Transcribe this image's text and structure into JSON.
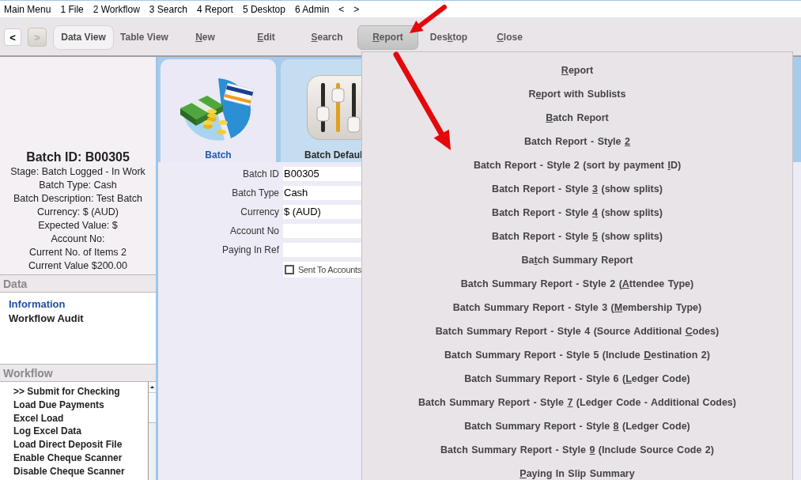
{
  "menu_bar": {
    "items": [
      "Main Menu",
      "1 File",
      "2 Workflow",
      "3 Search",
      "4 Report",
      "5 Desktop",
      "6 Admin",
      "<",
      ">"
    ]
  },
  "toolbar": {
    "nav": [
      {
        "label": "<",
        "disabled": false
      },
      {
        "label": ">",
        "disabled": true
      }
    ],
    "buttons": [
      {
        "label": "Data View",
        "selected": true,
        "expanded": false
      },
      {
        "label": "Table View",
        "selected": false,
        "expanded": false
      },
      {
        "access_key": "N",
        "text_after": "ew",
        "selected": false,
        "expanded": false
      },
      {
        "access_key": "E",
        "text_after": "dit",
        "selected": false,
        "expanded": false
      },
      {
        "access_key": "S",
        "text_after": "earch",
        "selected": false,
        "expanded": false
      },
      {
        "access_key": "R",
        "text_after": "eport",
        "selected": false,
        "expanded": true
      },
      {
        "text_before": "Des",
        "access_key": "k",
        "text_after": "top",
        "selected": false,
        "expanded": false
      },
      {
        "access_key": "C",
        "text_after": "lose",
        "selected": false,
        "expanded": false
      }
    ]
  },
  "summary": {
    "title": "Batch ID: B00305",
    "lines": [
      "Stage: Batch Logged - In Work",
      "Batch Type: Cash",
      "Batch Description: Test Batch",
      "Currency: $ (AUD)",
      "Expected Value: $",
      "Account No:",
      "Current No. of Items 2",
      "Current Value $200.00"
    ]
  },
  "data_section": {
    "title": "Data",
    "items": [
      {
        "label": "Information",
        "selected": true
      },
      {
        "label": "Workflow Audit",
        "selected": false
      }
    ]
  },
  "workflow_section": {
    "title": "Workflow",
    "items": [
      ">> Submit for Checking",
      "Load Due Payments",
      "Excel Load",
      "Log Excel Data",
      "Load Direct Deposit File",
      "Enable Cheque Scanner",
      "Disable Cheque Scanner"
    ]
  },
  "tabs": [
    {
      "label": "Batch",
      "selected": true
    },
    {
      "label": "Batch Defaul",
      "selected": false
    }
  ],
  "form": {
    "fields": [
      {
        "label": "Batch ID",
        "value": "B00305"
      },
      {
        "label": "Batch Type",
        "value": "Cash"
      },
      {
        "label": "Currency",
        "value": "$ (AUD)"
      },
      {
        "label": "Account No"
      },
      {
        "label": "Paying In Ref"
      }
    ],
    "checkbox": {
      "label": "Sent To Accounts",
      "checked": false
    }
  },
  "report_menu": {
    "items": [
      {
        "access_key": "R",
        "text_after": "eport"
      },
      {
        "text_before": "R",
        "access_key": "e",
        "text_after": "port with Sublists"
      },
      {
        "access_key": "B",
        "text_after": "atch Report"
      },
      {
        "text_before": "Batch Report - Style ",
        "access_key": "2"
      },
      {
        "text_before": "Batch Report - Style 2 (sort by payment ",
        "access_key": "I",
        "text_after": "D)"
      },
      {
        "text_before": "Batch Report - Style ",
        "access_key": "3",
        "text_after": " (show splits)"
      },
      {
        "text_before": "Batch Report - Style ",
        "access_key": "4",
        "text_after": " (show splits)"
      },
      {
        "text_before": "Batch Report - Style ",
        "access_key": "5",
        "text_after": " (show splits)"
      },
      {
        "text_before": "Ba",
        "access_key": "t",
        "text_after": "ch Summary Report"
      },
      {
        "text_before": "Batch Summary Report - Style 2 (",
        "access_key": "A",
        "text_after": "ttendee Type)"
      },
      {
        "text_before": "Batch Summary Report - Style 3 (",
        "access_key": "M",
        "text_after": "embership Type)"
      },
      {
        "text_before": "Batch Summary Report - Style 4 (Source Additional ",
        "access_key": "C",
        "text_after": "odes)"
      },
      {
        "text_before": "Batch Summary Report - Style 5 (Include ",
        "access_key": "D",
        "text_after": "estination 2)"
      },
      {
        "text_before": "Batch Summary Report - Style 6 (",
        "access_key": "L",
        "text_after": "edger Code)"
      },
      {
        "text_before": "Batch Summary Report - Style ",
        "access_key": "7",
        "text_after": " (Ledger Code - Additional Codes)"
      },
      {
        "text_before": "Batch Summary Report - Style ",
        "access_key": "8",
        "text_after": " (Ledger Code)"
      },
      {
        "text_before": "Batch Summary Report - Style ",
        "access_key": "9",
        "text_after": " (Include Source Code 2)"
      },
      {
        "access_key": "P",
        "text_after": "aying In Slip Summary"
      }
    ]
  }
}
